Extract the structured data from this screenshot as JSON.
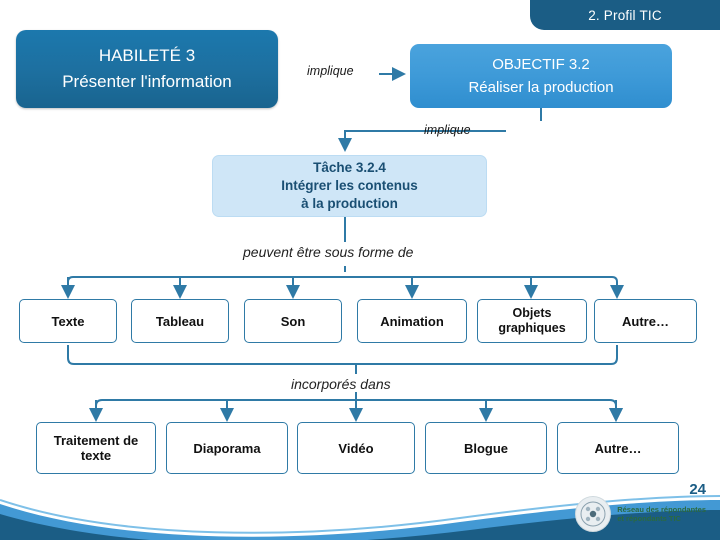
{
  "header": {
    "title": "2. Profil TIC"
  },
  "nodes": {
    "habilete": {
      "line1": "HABILETÉ 3",
      "line2": "Présenter l'information"
    },
    "objectif": {
      "line1": "OBJECTIF 3.2",
      "line2": "Réaliser la production"
    },
    "tache": {
      "line1": "Tâche 3.2.4",
      "line2": "Intégrer les contenus",
      "line3": "à la production"
    }
  },
  "connectors": {
    "implique_1": "implique",
    "implique_2": "implique",
    "formes": "peuvent être sous forme de",
    "incorpores": "incorporés dans"
  },
  "formes_row": [
    {
      "label": "Texte"
    },
    {
      "label": "Tableau"
    },
    {
      "label": "Son"
    },
    {
      "label": "Animation"
    },
    {
      "label": "Objets graphiques"
    },
    {
      "label": "Autre…"
    }
  ],
  "supports_row": [
    {
      "label": "Traitement de texte"
    },
    {
      "label": "Diaporama"
    },
    {
      "label": "Vidéo"
    },
    {
      "label": "Blogue"
    },
    {
      "label": "Autre…"
    }
  ],
  "footer": {
    "page_number": "24",
    "logo_line1": "Réseau des répondantes",
    "logo_line2": "et répondants TIC",
    "logo_mark": "reptic-logo-icon"
  },
  "colors": {
    "header_blue": "#1b5d85",
    "habilete_blue": "#1d6f9f",
    "objectif_blue": "#3e9ad8",
    "tache_blue": "#cfe6f7",
    "connector_blue": "#2f7aa6"
  }
}
